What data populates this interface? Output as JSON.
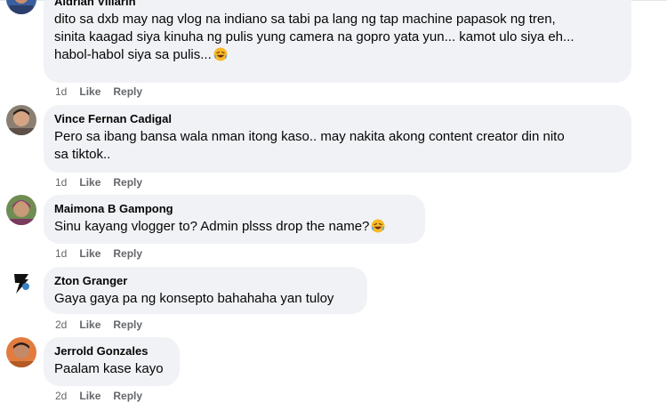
{
  "comments": [
    {
      "author": "Aldrian Villarin",
      "text": "dito sa dxb may nag vlog na indiano sa tabi pa lang ng tap machine papasok ng tren,\nsinita kaagad siya kinuha ng pulis yung camera na gopro yata yun... kamot ulo siya eh...\nhabol-habol siya sa pulis...",
      "emoji": "rolling-on-floor-laughing-emoji",
      "time": "1d",
      "like_label": "Like",
      "reply_label": "Reply"
    },
    {
      "author": "Vince Fernan Cadigal",
      "text": "Pero sa ibang bansa wala nman itong kaso.. may nakita akong content creator din nito\nsa tiktok..",
      "time": "1d",
      "like_label": "Like",
      "reply_label": "Reply"
    },
    {
      "author": "Maimona B Gampong",
      "text": "Sinu kayang vlogger to? Admin plsss drop the name?",
      "emoji": "rolling-on-floor-laughing-emoji",
      "time": "1d",
      "like_label": "Like",
      "reply_label": "Reply"
    },
    {
      "author": "Zton Granger",
      "text": "Gaya gaya pa ng konsepto bahahaha yan tuloy",
      "time": "2d",
      "like_label": "Like",
      "reply_label": "Reply"
    },
    {
      "author": "Jerrold Gonzales",
      "text": "Paalam kase kayo",
      "time": "2d",
      "like_label": "Like",
      "reply_label": "Reply"
    }
  ],
  "colors": {
    "bubble": "#f0f2f5",
    "text": "#050505",
    "meta": "#65676b",
    "emoji_face": "#f7b928"
  }
}
